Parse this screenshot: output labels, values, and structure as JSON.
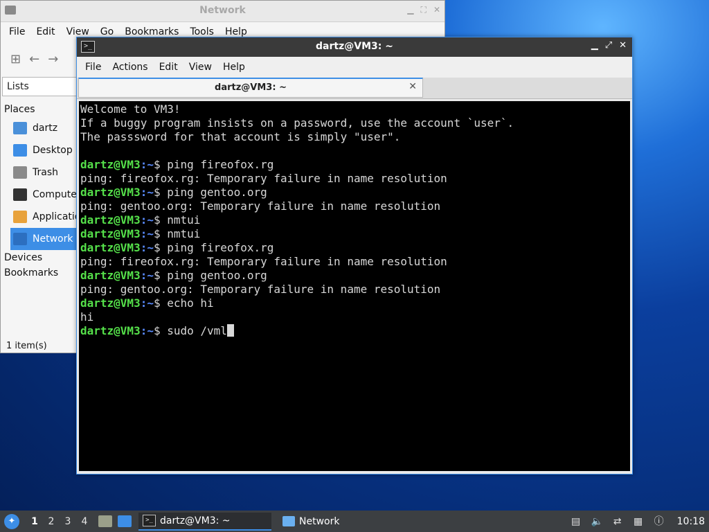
{
  "file_manager": {
    "title": "Network",
    "menu": [
      "File",
      "Edit",
      "View",
      "Go",
      "Bookmarks",
      "Tools",
      "Help"
    ],
    "side_pane_mode": "Lists",
    "sections": {
      "places": "Places",
      "devices": "Devices",
      "bookmarks": "Bookmarks"
    },
    "places": [
      {
        "label": "dartz",
        "icon": "home-folder-icon",
        "color": "#4a90d9"
      },
      {
        "label": "Desktop",
        "icon": "desktop-icon",
        "color": "#3d8ee6"
      },
      {
        "label": "Trash",
        "icon": "trash-icon",
        "color": "#8a8a8a"
      },
      {
        "label": "Computer",
        "icon": "computer-icon",
        "color": "#333333"
      },
      {
        "label": "Applications",
        "icon": "applications-icon",
        "color": "#e8a23b"
      },
      {
        "label": "Network",
        "icon": "network-icon",
        "color": "#3d8ee6"
      }
    ],
    "status": "1 item(s)"
  },
  "terminal": {
    "title": "dartz@VM3: ~",
    "menu": [
      "File",
      "Actions",
      "Edit",
      "View",
      "Help"
    ],
    "tab_label": "dartz@VM3: ~",
    "prompt_user": "dartz@VM3",
    "prompt_path": ":~",
    "prompt_symbol": "$ ",
    "lines": [
      {
        "text": "Welcome to VM3!"
      },
      {
        "text": "If a buggy program insists on a password, use the account `user`."
      },
      {
        "text": "The passsword for that account is simply \"user\"."
      },
      {
        "text": ""
      },
      {
        "prompt": true,
        "text": "ping fireofox.rg"
      },
      {
        "text": "ping: fireofox.rg: Temporary failure in name resolution"
      },
      {
        "prompt": true,
        "text": "ping gentoo.org"
      },
      {
        "text": "ping: gentoo.org: Temporary failure in name resolution"
      },
      {
        "prompt": true,
        "text": "nmtui"
      },
      {
        "prompt": true,
        "text": "nmtui"
      },
      {
        "prompt": true,
        "text": "ping fireofox.rg"
      },
      {
        "text": "ping: fireofox.rg: Temporary failure in name resolution"
      },
      {
        "prompt": true,
        "text": "ping gentoo.org"
      },
      {
        "text": "ping: gentoo.org: Temporary failure in name resolution"
      },
      {
        "prompt": true,
        "text": "echo hi"
      },
      {
        "text": "hi"
      },
      {
        "prompt": true,
        "text": "sudo /vml",
        "cursor": true
      }
    ]
  },
  "taskbar": {
    "workspaces": [
      "1",
      "2",
      "3",
      "4"
    ],
    "active_workspace": "1",
    "tasks": [
      {
        "label": "dartz@VM3: ~",
        "icon": "terminal-icon",
        "active": true
      },
      {
        "label": "Network",
        "icon": "folder-icon",
        "active": false
      }
    ],
    "clock": "10:18"
  }
}
